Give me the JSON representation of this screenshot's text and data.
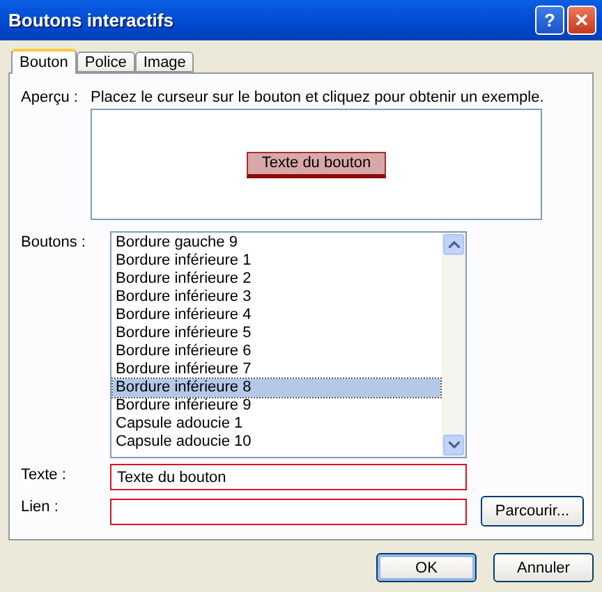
{
  "window": {
    "title": "Boutons interactifs",
    "help_glyph": "?",
    "close_glyph": "✕"
  },
  "tabs": [
    {
      "label": "Bouton",
      "selected": true
    },
    {
      "label": "Police",
      "selected": false
    },
    {
      "label": "Image",
      "selected": false
    }
  ],
  "preview": {
    "label": "Aperçu :",
    "hint": "Placez le curseur sur le bouton et cliquez pour obtenir un exemple.",
    "sample_button": "Texte du bouton"
  },
  "buttons_list": {
    "label": "Boutons :",
    "items": [
      {
        "label": "Bordure gauche 9",
        "selected": false
      },
      {
        "label": "Bordure inférieure 1",
        "selected": false
      },
      {
        "label": "Bordure inférieure 2",
        "selected": false
      },
      {
        "label": "Bordure inférieure 3",
        "selected": false
      },
      {
        "label": "Bordure inférieure 4",
        "selected": false
      },
      {
        "label": "Bordure inférieure 5",
        "selected": false
      },
      {
        "label": "Bordure inférieure 6",
        "selected": false
      },
      {
        "label": "Bordure inférieure 7",
        "selected": false
      },
      {
        "label": "Bordure inférieure 8",
        "selected": true
      },
      {
        "label": "Bordure inférieure 9",
        "selected": false
      },
      {
        "label": "Capsule adoucie 1",
        "selected": false
      },
      {
        "label": "Capsule adoucie 10",
        "selected": false
      }
    ]
  },
  "text_field": {
    "label": "Texte :",
    "value": "Texte du bouton"
  },
  "link_field": {
    "label": "Lien :"
  },
  "browse_button": "Parcourir...",
  "footer_buttons": [
    {
      "label": "OK",
      "default": true
    },
    {
      "label": "Annuler",
      "default": false
    }
  ]
}
